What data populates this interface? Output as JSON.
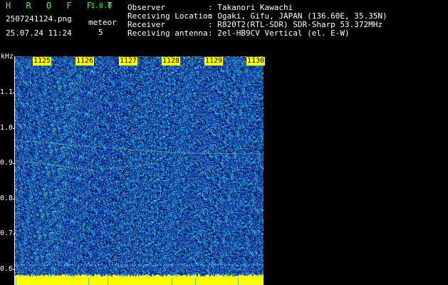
{
  "app": {
    "name": "H R O F F T",
    "version": "1.0.0"
  },
  "file": {
    "filename": "2507241124.png",
    "datetime": "25.07.24 11:24"
  },
  "meteor": {
    "label": "meteor",
    "count": "5"
  },
  "info": [
    {
      "key": "Observer",
      "value": ": Takanori Kawachi"
    },
    {
      "key": "Receiving Location",
      "value": ": Ogaki, Gifu, JAPAN (136.60E, 35.35N)"
    },
    {
      "key": "Receiver",
      "value": ": R820T2(RTL-SDR) SDR-Sharp 53.372MHz"
    },
    {
      "key": "Receiving antenna",
      "value": ": 2el-HB9CV Vertical (el. E-W)"
    }
  ],
  "axis": {
    "unit": "kHz",
    "y_ticks": [
      "1.1",
      "1.0",
      "0.9",
      "0.8",
      "0.7",
      "0.6"
    ],
    "x_ticks": [
      "1125",
      "1126",
      "1127",
      "1128",
      "1129",
      "1130"
    ]
  },
  "colors": {
    "background": "#000000",
    "spectrum_base": "#1a2fa0",
    "noise_cyan": "#19c8d8",
    "noise_dark": "#000a40",
    "trace": "#9ad0a0",
    "baseline": "#ffff00",
    "title": "#3fff3f"
  }
}
